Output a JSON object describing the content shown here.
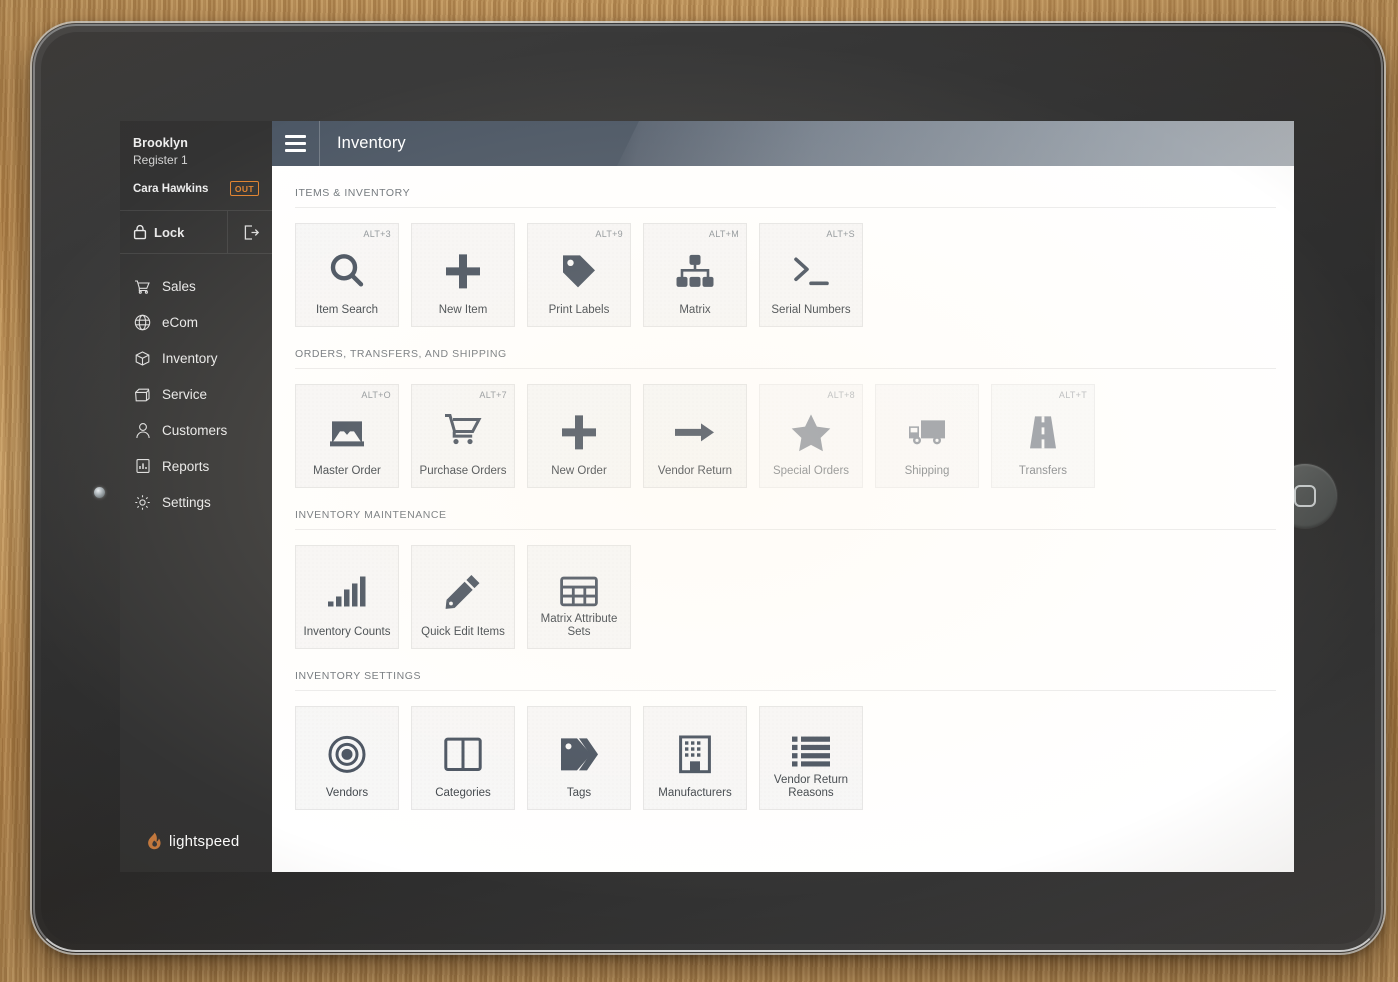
{
  "sidebar": {
    "store_name": "Brooklyn",
    "register_name": "Register 1",
    "user_name": "Cara Hawkins",
    "status_badge": "OUT",
    "lock_label": "Lock",
    "logout_icon": "logout-icon",
    "lock_icon": "padlock-icon",
    "nav_items": [
      {
        "label": "Sales",
        "icon": "cart-icon"
      },
      {
        "label": "eCom",
        "icon": "globe-icon"
      },
      {
        "label": "Inventory",
        "icon": "box-icon"
      },
      {
        "label": "Service",
        "icon": "toolbox-icon"
      },
      {
        "label": "Customers",
        "icon": "person-icon"
      },
      {
        "label": "Reports",
        "icon": "bar-chart-icon"
      },
      {
        "label": "Settings",
        "icon": "gear-icon"
      }
    ],
    "brand_name": "lightspeed",
    "brand_icon": "flame-icon",
    "brand_color": "#c87c3f"
  },
  "topbar": {
    "menu_icon": "hamburger-icon",
    "title": "Inventory",
    "bg_color": "#4c5765"
  },
  "sections": [
    {
      "heading": "ITEMS & INVENTORY",
      "tiles": [
        {
          "label": "Item Search",
          "shortcut": "ALT+3",
          "icon": "magnifier-icon",
          "dim": false
        },
        {
          "label": "New Item",
          "shortcut": "",
          "icon": "plus-icon",
          "dim": false
        },
        {
          "label": "Print Labels",
          "shortcut": "ALT+9",
          "icon": "tag-icon",
          "dim": false
        },
        {
          "label": "Matrix",
          "shortcut": "ALT+M",
          "icon": "matrix-icon",
          "dim": false
        },
        {
          "label": "Serial Numbers",
          "shortcut": "ALT+S",
          "icon": "terminal-icon",
          "dim": false
        }
      ]
    },
    {
      "heading": "ORDERS, TRANSFERS, AND SHIPPING",
      "tiles": [
        {
          "label": "Master Order",
          "shortcut": "ALT+O",
          "icon": "inbox-tray-icon",
          "dim": false
        },
        {
          "label": "Purchase Orders",
          "shortcut": "ALT+7",
          "icon": "shopping-cart-icon",
          "dim": false
        },
        {
          "label": "New Order",
          "shortcut": "",
          "icon": "plus-icon",
          "dim": false
        },
        {
          "label": "Vendor Return",
          "shortcut": "",
          "icon": "arrow-right-icon",
          "dim": false
        },
        {
          "label": "Special Orders",
          "shortcut": "ALT+8",
          "icon": "star-icon",
          "dim": true
        },
        {
          "label": "Shipping",
          "shortcut": "",
          "icon": "truck-icon",
          "dim": true
        },
        {
          "label": "Transfers",
          "shortcut": "ALT+T",
          "icon": "road-icon",
          "dim": true
        }
      ]
    },
    {
      "heading": "INVENTORY MAINTENANCE",
      "tiles": [
        {
          "label": "Inventory Counts",
          "shortcut": "",
          "icon": "ascending-bars-icon",
          "dim": false
        },
        {
          "label": "Quick Edit Items",
          "shortcut": "",
          "icon": "pencil-icon",
          "dim": false
        },
        {
          "label": "Matrix Attribute Sets",
          "shortcut": "",
          "icon": "grid-table-icon",
          "dim": false
        }
      ]
    },
    {
      "heading": "INVENTORY SETTINGS",
      "tiles": [
        {
          "label": "Vendors",
          "shortcut": "",
          "icon": "target-icon",
          "dim": false
        },
        {
          "label": "Categories",
          "shortcut": "",
          "icon": "columns-icon",
          "dim": false
        },
        {
          "label": "Tags",
          "shortcut": "",
          "icon": "double-tag-icon",
          "dim": false
        },
        {
          "label": "Manufacturers",
          "shortcut": "",
          "icon": "building-icon",
          "dim": false
        },
        {
          "label": "Vendor Return Reasons",
          "shortcut": "",
          "icon": "list-icon",
          "dim": false
        }
      ]
    }
  ],
  "device": {
    "home_button": "home-button",
    "camera": "front-camera"
  }
}
